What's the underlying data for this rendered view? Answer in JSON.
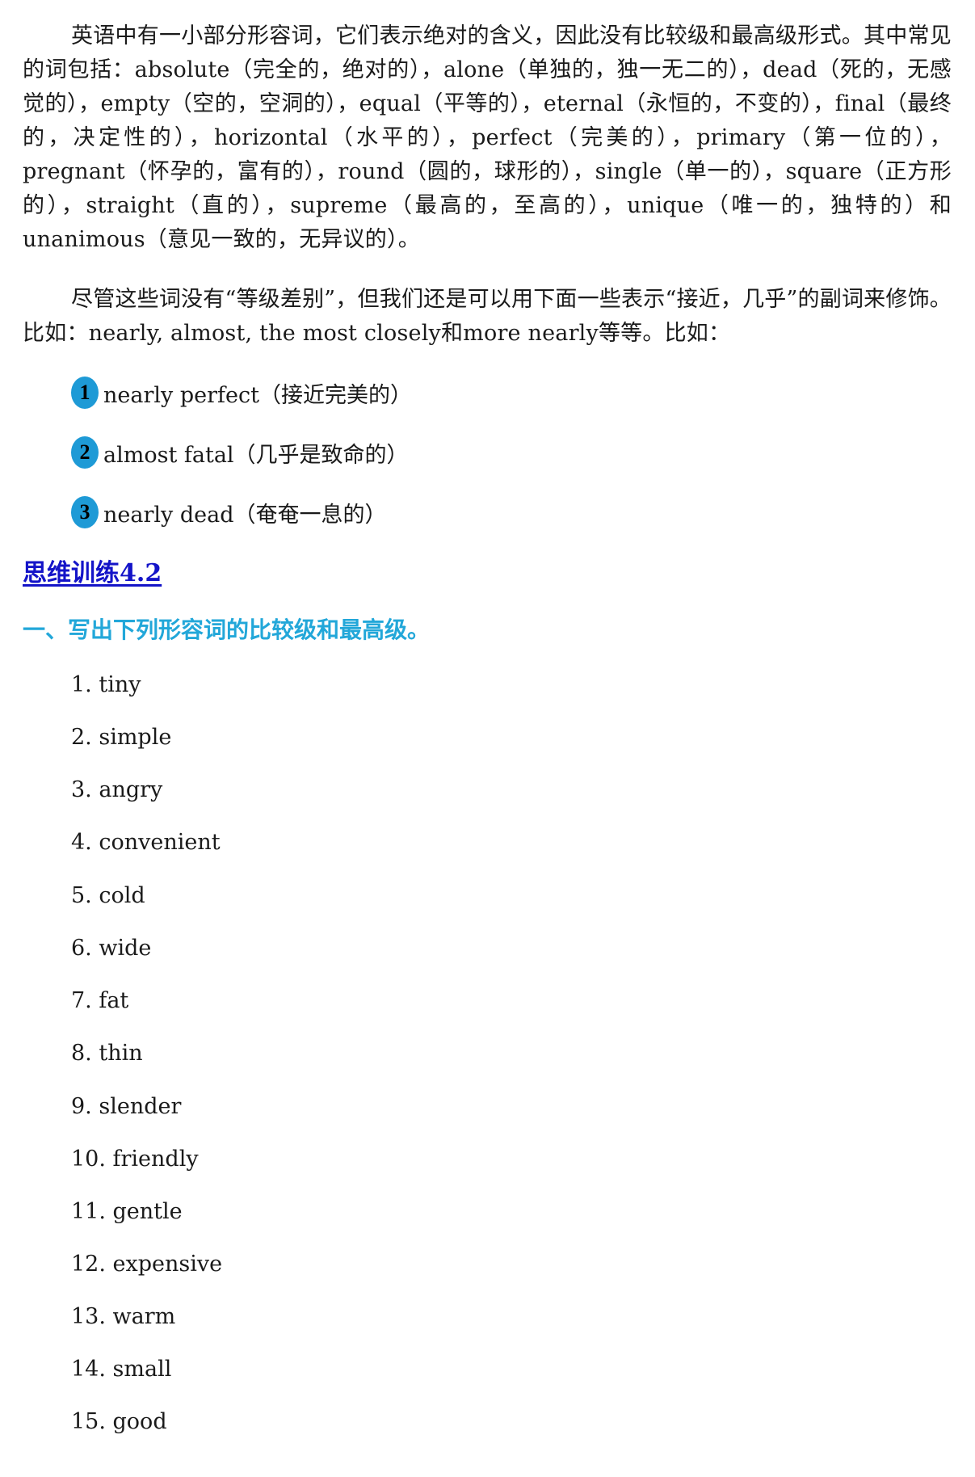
{
  "intro_paragraph": "英语中有一小部分形容词，它们表示绝对的含义，因此没有比较级和最高级形式。其中常见的词包括：absolute（完全的，绝对的），alone（单独的，独一无二的），dead（死的，无感觉的），empty（空的，空洞的），equal（平等的），eternal（永恒的，不变的），final（最终的，决定性的），horizontal（水平的），perfect（完美的），primary（第一位的），pregnant（怀孕的，富有的），round（圆的，球形的），single（单一的），square（正方形的），straight（直的），supreme（最高的，至高的），unique（唯一的，独特的）和unanimous（意见一致的，无异议的）。",
  "modifier_paragraph": "尽管这些词没有“等级差别”，但我们还是可以用下面一些表示“接近，几乎”的副词来修饰。比如：nearly, almost, the most closely和more nearly等等。比如：",
  "examples": [
    {
      "number": "1",
      "text": "nearly perfect（接近完美的）"
    },
    {
      "number": "2",
      "text": "almost fatal（几乎是致命的）"
    },
    {
      "number": "3",
      "text": "nearly dead（奄奄一息的）"
    }
  ],
  "section_title": "思维训练4.2",
  "exercise_heading": "一、写出下列形容词的比较级和最高级。",
  "words": [
    "1. tiny",
    "2. simple",
    "3. angry",
    "4. convenient",
    "5. cold",
    "6. wide",
    "7. fat",
    "8. thin",
    "9. slender",
    "10. friendly",
    "11. gentle",
    "12. expensive",
    "13. warm",
    "14. small",
    "15. good"
  ],
  "colors": {
    "badge": "#1e9ad6",
    "section_title": "#1414c8",
    "exercise_heading": "#22a7d9",
    "text": "#1a1a1a"
  }
}
